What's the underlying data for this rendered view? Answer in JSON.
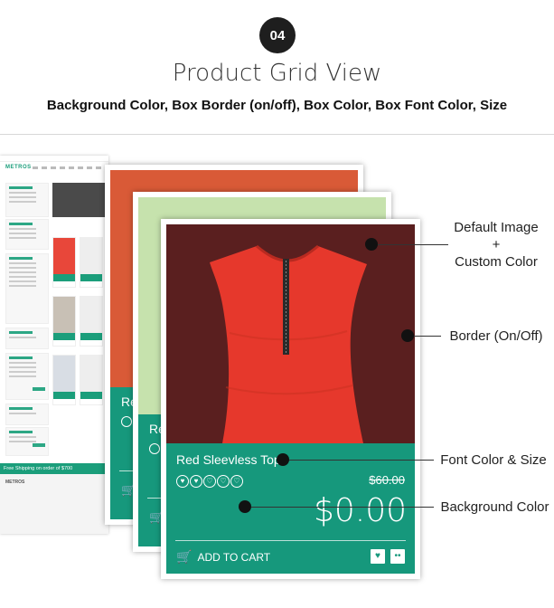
{
  "header": {
    "step_number": "04",
    "title": "Product Grid View",
    "subtitle": "Background Color, Box Border (on/off), Box Color, Box Font Color, Size"
  },
  "mini_site": {
    "logo": "METROS",
    "free_shipping": "Free Shipping on order of $700",
    "footer_logo": "METROS"
  },
  "back_cards": {
    "card1_name_partial": "Re",
    "card2_name_partial": "Re"
  },
  "product_card": {
    "name": "Red Sleevless Top",
    "old_price": "$60.00",
    "price": "$0.00",
    "add_to_cart": "ADD TO CART",
    "image_bg_color": "#5a1f1f",
    "panel_color": "#16987c"
  },
  "annotations": {
    "image": [
      "Default Image",
      "+",
      "Custom Color"
    ],
    "border": "Border (On/Off)",
    "font": "Font Color & Size",
    "background": "Background Color"
  }
}
